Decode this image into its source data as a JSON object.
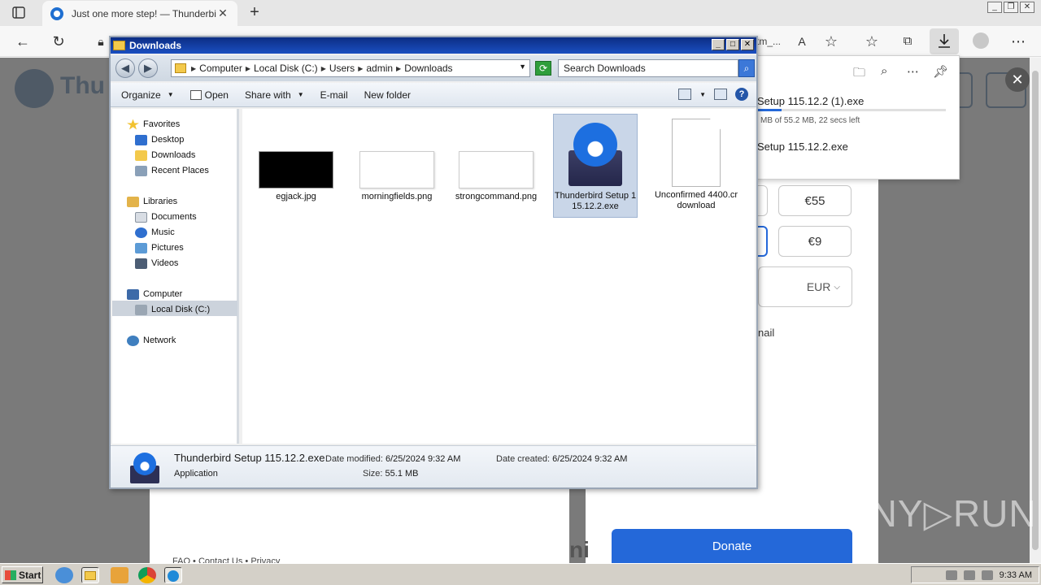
{
  "browser": {
    "tab_title": "Just one more step! — Thunderbird",
    "address_tail": "tm_...",
    "new_tab": "+",
    "tab_close": "✕"
  },
  "page": {
    "logo_text": "Thu",
    "amounts": [
      "€55",
      "€9"
    ],
    "currency": "EUR",
    "email_fragment": "nail",
    "donate_label": "Donate",
    "footer_links": "FAQ  •  Contact Us  •  Privacy"
  },
  "downloads_panel": {
    "item1_name": "Setup 115.12.2 (1).exe",
    "item1_progress": 0.13,
    "item1_meta": "MB of 55.2 MB, 22 secs left",
    "item2_name": "Setup 115.12.2.exe"
  },
  "explorer": {
    "title": "Downloads",
    "breadcrumbs": [
      "Computer",
      "Local Disk (C:)",
      "Users",
      "admin",
      "Downloads"
    ],
    "search_placeholder": "Search Downloads",
    "commands": {
      "organize": "Organize",
      "open": "Open",
      "share_with": "Share with",
      "email": "E-mail",
      "new_folder": "New folder"
    },
    "nav": {
      "favorites": "Favorites",
      "desktop": "Desktop",
      "downloads": "Downloads",
      "recent_places": "Recent Places",
      "libraries": "Libraries",
      "documents": "Documents",
      "music": "Music",
      "pictures": "Pictures",
      "videos": "Videos",
      "computer": "Computer",
      "local_disk": "Local Disk (C:)",
      "network": "Network"
    },
    "files": [
      {
        "name": "egjack.jpg"
      },
      {
        "name": "morningfields.png"
      },
      {
        "name": "strongcommand.png"
      },
      {
        "name": "Thunderbird Setup 115.12.2.exe"
      },
      {
        "name": "Unconfirmed 4400.crdownload"
      }
    ],
    "details": {
      "name": "Thunderbird Setup 115.12.2.exe",
      "type": "Application",
      "date_modified_label": "Date modified:",
      "date_modified": "6/25/2024 9:32 AM",
      "date_created_label": "Date created:",
      "date_created": "6/25/2024 9:32 AM",
      "size_label": "Size:",
      "size": "55.1 MB"
    }
  },
  "watermark": "ANY▷RUN",
  "taskbar": {
    "start_label": "Start",
    "clock": "9:33 AM"
  },
  "colors": {
    "accent": "#2468d9",
    "titlebar": "#0c2d84"
  }
}
